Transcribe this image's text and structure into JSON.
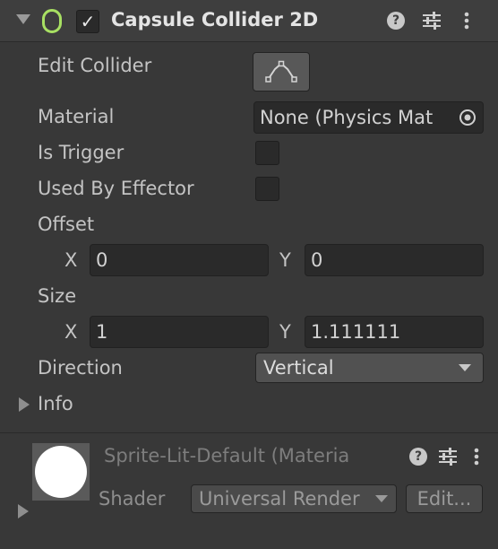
{
  "component": {
    "title": "Capsule Collider 2D",
    "enabled_checkmark": "✓",
    "icons": [
      "foldout-expanded-icon",
      "capsule-collider-icon",
      "help-icon",
      "preset-settings-icon",
      "more-options-icon"
    ]
  },
  "help_glyph": "?",
  "properties": {
    "edit_collider": {
      "label": "Edit Collider",
      "button_icon": "edit-collider-icon"
    },
    "material": {
      "label": "Material",
      "value": "None (Physics Mat",
      "picker_icon": "object-picker-icon"
    },
    "is_trigger": {
      "label": "Is Trigger",
      "checked": false
    },
    "used_by_effector": {
      "label": "Used By Effector",
      "checked": false
    },
    "offset": {
      "label": "Offset",
      "x_label": "X",
      "x": "0",
      "y_label": "Y",
      "y": "0"
    },
    "size": {
      "label": "Size",
      "x_label": "X",
      "x": "1",
      "y_label": "Y",
      "y": "1.111111"
    },
    "direction": {
      "label": "Direction",
      "value": "Vertical"
    },
    "info": {
      "label": "Info"
    }
  },
  "material_section": {
    "name": "Sprite-Lit-Default (Materia",
    "shader_label": "Shader",
    "shader_value": "Universal Render",
    "edit_button": "Edit..."
  },
  "colors": {
    "background": "#383838",
    "header": "#3e3e3e",
    "capsule_icon": "#a8e063",
    "field_bg": "#2a2a2a"
  }
}
